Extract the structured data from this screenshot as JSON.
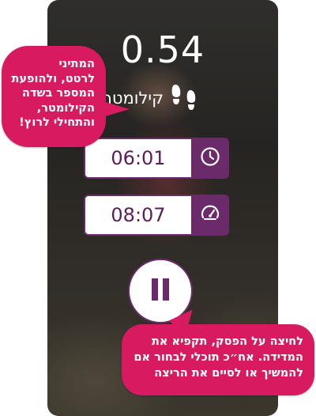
{
  "tracker": {
    "distance_value": "0.54",
    "distance_unit": "קילומטר",
    "duration_value": "06:01",
    "pace_value": "08:07",
    "icons": {
      "distance": "footprints-icon",
      "duration": "clock-icon",
      "pace": "speedometer-icon",
      "control": "pause-icon"
    },
    "accent_color": "#6b2a6a"
  },
  "callouts": {
    "top": {
      "lines": [
        "המתיני",
        "לרטט, ולהופעת",
        "המספר בשדה",
        "הקילומטר,",
        "והתחילי לרוץ!"
      ]
    },
    "bottom": {
      "lines": [
        "לחיצה על הפסק, תקפיא את",
        "המדידה. אח״כ תוכלי לבחור אם",
        "להמשיך או לסיים את הריצה"
      ]
    },
    "color": "#d81b60"
  }
}
